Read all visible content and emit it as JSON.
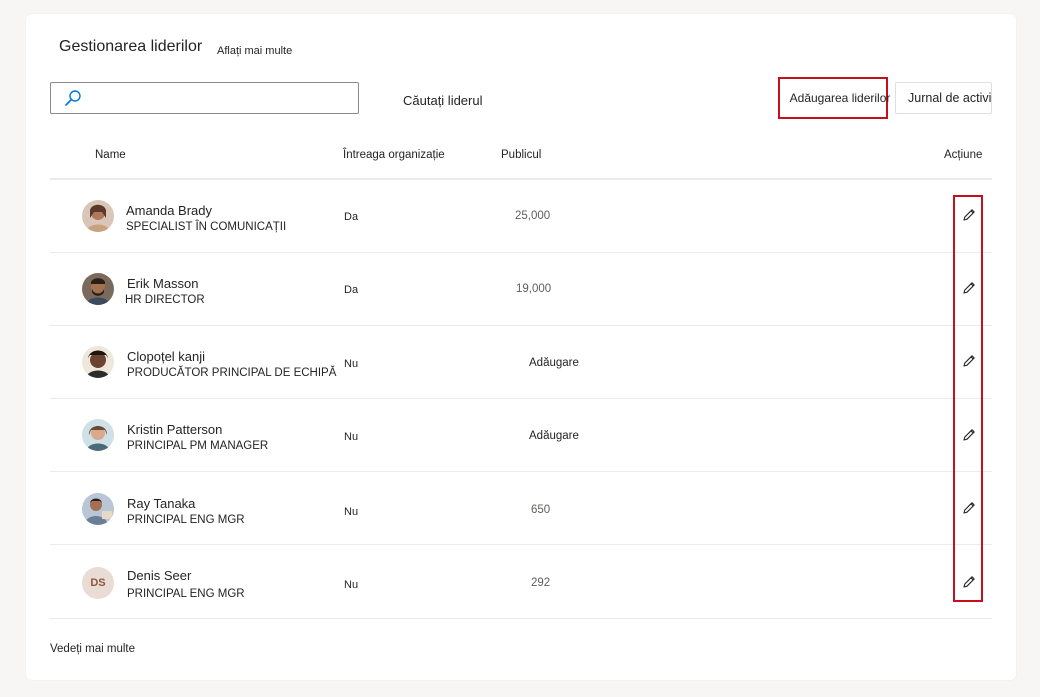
{
  "page": {
    "title": "Gestionarea liderilor",
    "learn_more": "Aflați mai multe",
    "search_label": "Căutați liderul",
    "search_placeholder": "",
    "add_leaders": "Adăugarea liderilor",
    "activity_log": "Jurnal de activitate",
    "see_more": "Vedeți mai multe"
  },
  "table": {
    "columns": {
      "name": "Name",
      "org": "Întreaga organizație",
      "audience": "Publicul",
      "actions": "Acțiune"
    },
    "rows": [
      {
        "name": "Amanda Brady",
        "role": "SPECIALIST ÎN COMUNICAȚII",
        "org": "Da",
        "audience": "25,000",
        "avatar": "photo"
      },
      {
        "name": "Erik Masson",
        "role": "HR DIRECTOR",
        "org": "Da",
        "audience": "19,000",
        "avatar": "photo"
      },
      {
        "name": "Clopoțel kanji",
        "role": "PRODUCĂTOR PRINCIPAL DE ECHIPĂ",
        "org": "Nu",
        "audience": "Adăugare",
        "avatar": "photo"
      },
      {
        "name": "Kristin Patterson",
        "role": "PRINCIPAL PM MANAGER",
        "org": "Nu",
        "audience": "Adăugare",
        "avatar": "photo"
      },
      {
        "name": "Ray Tanaka",
        "role": "PRINCIPAL ENG MGR",
        "org": "Nu",
        "audience": "650",
        "avatar": "photo"
      },
      {
        "name": "Denis Seer",
        "role": "PRINCIPAL ENG MGR",
        "org": "Nu",
        "audience": "292",
        "avatar": "DS"
      }
    ]
  },
  "colors": {
    "highlight": "#c50f1f",
    "accent": "#0078d4"
  },
  "icons": {
    "search": "search-icon",
    "edit": "pencil-icon"
  }
}
